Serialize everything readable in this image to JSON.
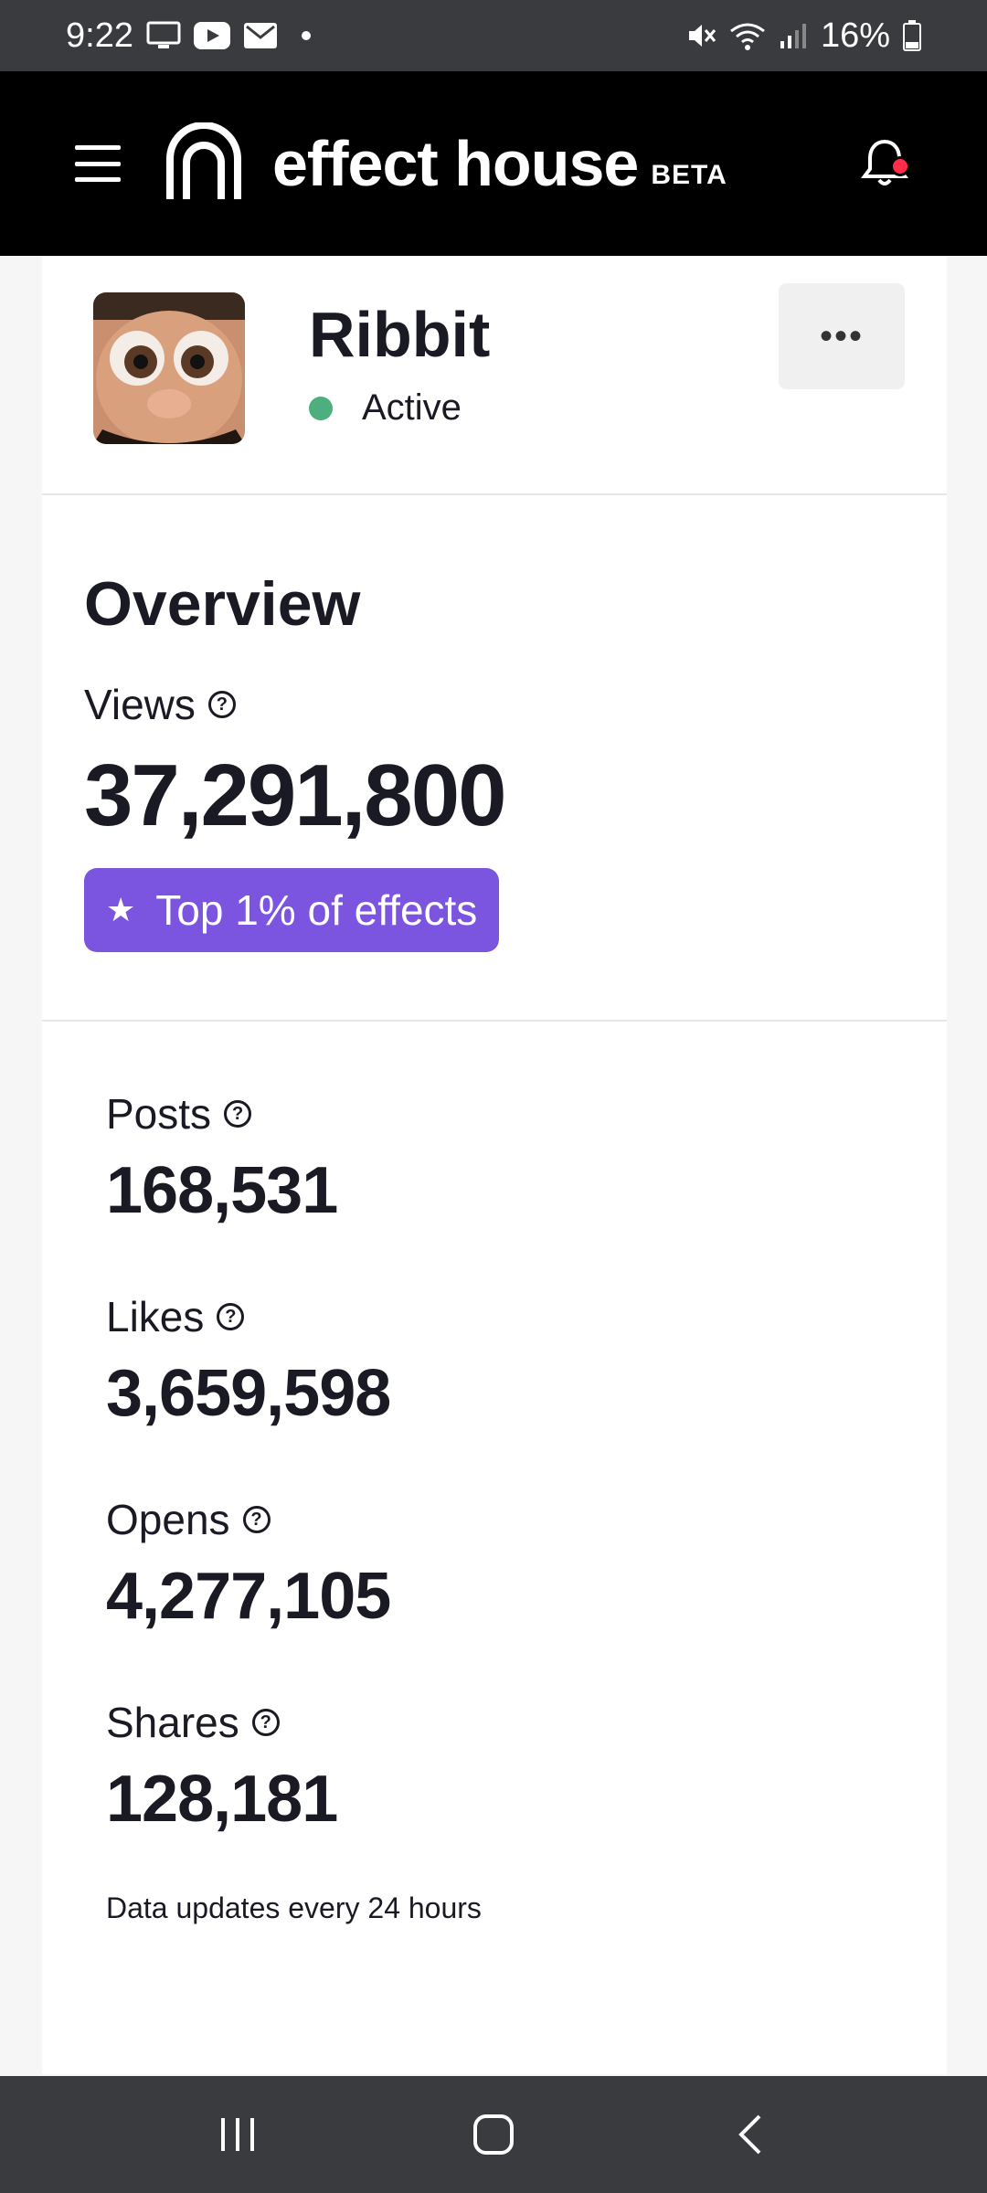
{
  "status_bar": {
    "time": "9:22",
    "battery": "16%"
  },
  "header": {
    "logo_text": "effect house",
    "beta_label": "BETA",
    "notification_color": "#ff2d4a"
  },
  "effect": {
    "name": "Ribbit",
    "status": "Active",
    "status_color": "#4caf7d",
    "more_label": "•••"
  },
  "overview": {
    "title": "Overview",
    "views_label": "Views",
    "views_value": "37,291,800",
    "badge_label": "Top 1% of effects",
    "badge_color": "#7b54e0"
  },
  "stats": [
    {
      "label": "Posts",
      "value": "168,531"
    },
    {
      "label": "Likes",
      "value": "3,659,598"
    },
    {
      "label": "Opens",
      "value": "4,277,105"
    },
    {
      "label": "Shares",
      "value": "128,181"
    }
  ],
  "footnote": "Data updates every 24 hours"
}
